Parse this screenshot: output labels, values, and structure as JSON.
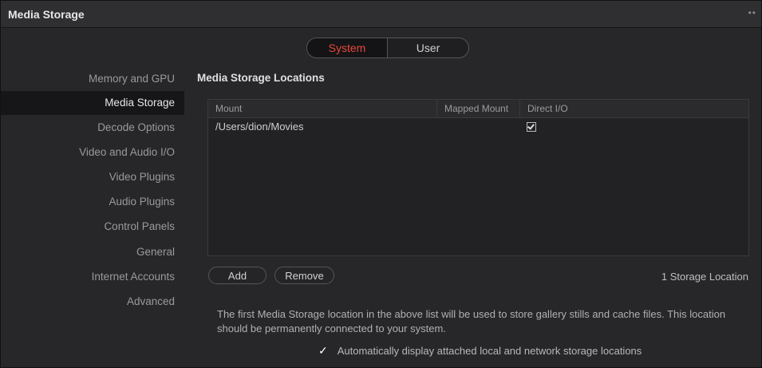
{
  "window": {
    "title": "Media Storage",
    "menu_glyph": "••"
  },
  "segmented": {
    "options": [
      "System",
      "User"
    ],
    "selected": "System"
  },
  "sidebar": {
    "items": [
      {
        "label": "Memory and GPU"
      },
      {
        "label": "Media Storage",
        "active": true
      },
      {
        "label": "Decode Options"
      },
      {
        "label": "Video and Audio I/O"
      },
      {
        "label": "Video Plugins"
      },
      {
        "label": "Audio Plugins"
      },
      {
        "label": "Control Panels"
      },
      {
        "label": "General"
      },
      {
        "label": "Internet Accounts"
      },
      {
        "label": "Advanced"
      }
    ]
  },
  "main": {
    "section_title": "Media Storage Locations",
    "table": {
      "columns": [
        "Mount",
        "Mapped Mount",
        "Direct I/O"
      ],
      "rows": [
        {
          "mount": "/Users/dion/Movies",
          "mapped": "",
          "direct_io": true
        }
      ]
    },
    "buttons": {
      "add": "Add",
      "remove": "Remove"
    },
    "count_label": "1 Storage Location",
    "info_text": "The first Media Storage location in the above list will be used to store gallery stills and cache files. This location should be permanently connected to your system.",
    "auto_display": {
      "checked": true,
      "label": "Automatically display attached local and network storage locations"
    }
  },
  "colors": {
    "accent": "#e8483a",
    "background": "#27272a",
    "active_row": "#161618"
  }
}
